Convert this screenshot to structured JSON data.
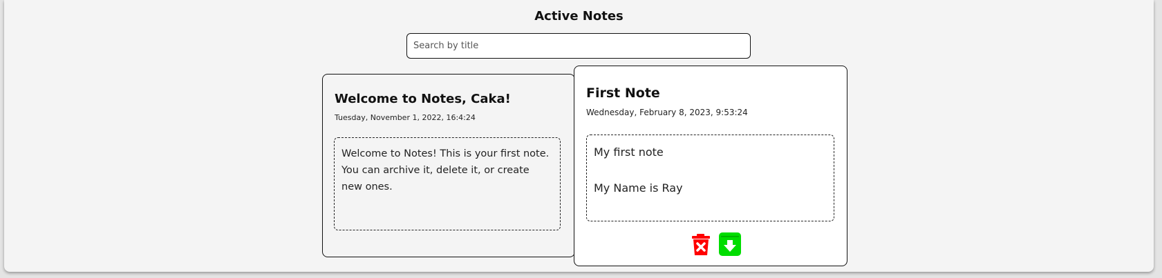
{
  "header": {
    "title": "Active Notes"
  },
  "search": {
    "placeholder": "Search by title",
    "value": ""
  },
  "notes": [
    {
      "title": "Welcome to Notes, Caka!",
      "date": "Tuesday, November 1, 2022, 16:4:24",
      "body": "Welcome to Notes! This is your first note. You can archive it, delete it, or create new ones.",
      "icon_color": "",
      "selected": false
    },
    {
      "title": "First Note",
      "date": "Wednesday, February 8, 2023, 9:53:24",
      "body_lines": [
        "My first note",
        "",
        "My Name is Ray"
      ],
      "selected": true,
      "actions": {
        "delete_icon": "trash-delete-icon",
        "archive_icon": "archive-download-icon"
      }
    }
  ],
  "colors": {
    "delete": "#ff0000",
    "archive": "#00dd00",
    "background": "#f4f4f4",
    "selected_card": "#ffffff"
  }
}
